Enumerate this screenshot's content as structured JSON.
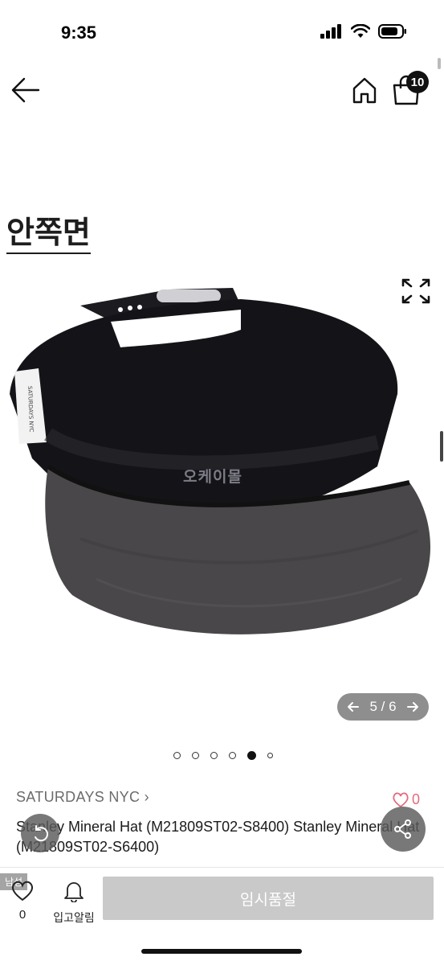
{
  "status_bar": {
    "time": "9:35"
  },
  "nav": {
    "cart_count": "10"
  },
  "gallery": {
    "heading": "안쪽면",
    "watermark": "오케이몰",
    "pager_text": "5 / 6",
    "dots_total": 6,
    "dots_active": 5
  },
  "product": {
    "brand": "SATURDAYS NYC",
    "like_count": "0",
    "title": "Stanley Mineral Hat (M21809ST02-S8400) Stanley Mineral Hat (M21809ST02-S6400)"
  },
  "bottom_bar": {
    "small_tag": "남성",
    "wish_count": "0",
    "alert_label": "입고알림",
    "soldout_label": "임시품절"
  },
  "colors": {
    "accent_heart": "#e46b7b",
    "button_disabled": "#c9c9c9",
    "cap_crown": "#141418",
    "cap_brim": "#4a474b"
  }
}
